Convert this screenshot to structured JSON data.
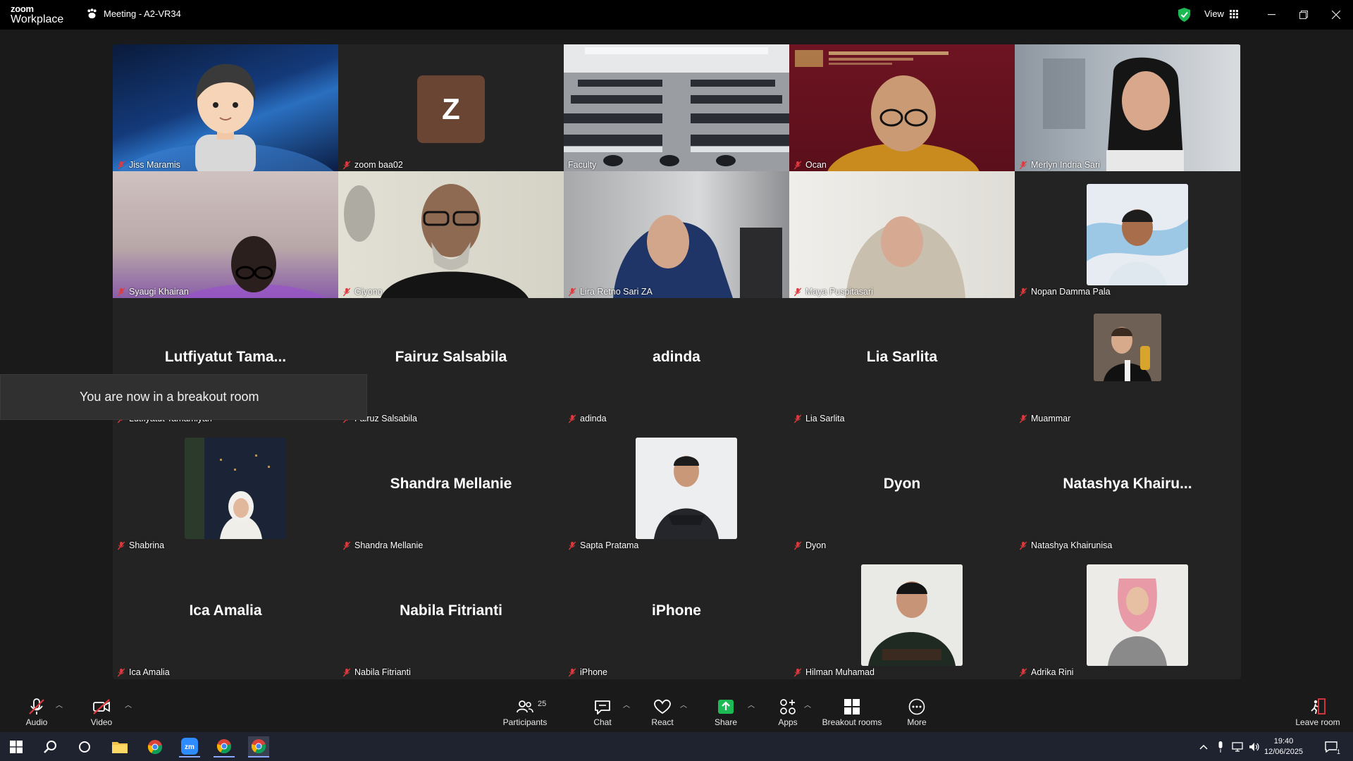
{
  "app": {
    "brand_top": "zoom",
    "brand_bottom": "Workplace",
    "meeting_title": "Meeting - A2-VR34",
    "view_label": "View"
  },
  "toast": {
    "message": "You are now in a breakout room"
  },
  "tiles": [
    {
      "label": "Jiss Maramis",
      "kind": "memoji"
    },
    {
      "label": "zoom baa02",
      "kind": "initial",
      "initial": "Z"
    },
    {
      "label": "Faculty",
      "kind": "classroom",
      "active": true
    },
    {
      "label": "Ocan",
      "kind": "video"
    },
    {
      "label": "Merlyn Indria Sari",
      "kind": "video"
    },
    {
      "label": "Syaugi Khairan",
      "kind": "video"
    },
    {
      "label": "Giyono",
      "kind": "video"
    },
    {
      "label": "Lira Retno Sari ZA",
      "kind": "video"
    },
    {
      "label": "Maya Puspitasari",
      "kind": "video"
    },
    {
      "label": "Nopan Damma Pala",
      "kind": "photo"
    },
    {
      "label": "Lutfiyatut Tamamiyah",
      "big": "Lutfiyatut  Tama...",
      "kind": "name"
    },
    {
      "label": "Fairuz Salsabila",
      "big": "Fairuz Salsabila",
      "kind": "name"
    },
    {
      "label": "adinda",
      "big": "adinda",
      "kind": "name"
    },
    {
      "label": "Lia Sarlita",
      "big": "Lia Sarlita",
      "kind": "name"
    },
    {
      "label": "Muammar",
      "kind": "photo-small"
    },
    {
      "label": "Shabrina",
      "kind": "photo"
    },
    {
      "label": "Shandra Mellanie",
      "big": "Shandra Mellanie",
      "kind": "name"
    },
    {
      "label": "Sapta Pratama",
      "kind": "photo"
    },
    {
      "label": "Dyon",
      "big": "Dyon",
      "kind": "name"
    },
    {
      "label": "Natashya Khairunisa",
      "big": "Natashya  Khairu...",
      "kind": "name"
    },
    {
      "label": "Ica Amalia",
      "big": "Ica Amalia",
      "kind": "name"
    },
    {
      "label": "Nabila Fitrianti",
      "big": "Nabila Fitrianti",
      "kind": "name"
    },
    {
      "label": "iPhone",
      "big": "iPhone",
      "kind": "name"
    },
    {
      "label": "Hilman Muhamad",
      "kind": "photo"
    },
    {
      "label": "Adrika Rini",
      "kind": "photo"
    }
  ],
  "toolbar": {
    "audio": "Audio",
    "video": "Video",
    "participants": "Participants",
    "participants_count": "25",
    "chat": "Chat",
    "react": "React",
    "share": "Share",
    "apps": "Apps",
    "breakout": "Breakout rooms",
    "more": "More",
    "leave": "Leave room"
  },
  "taskbar": {
    "time": "19:40",
    "date": "12/06/2025",
    "notif_count": "1"
  },
  "colors": {
    "active_speaker": "#2dd36f",
    "share_green": "#1db954",
    "muted_red": "#e0393e",
    "avatar_z": "#6b4534"
  }
}
